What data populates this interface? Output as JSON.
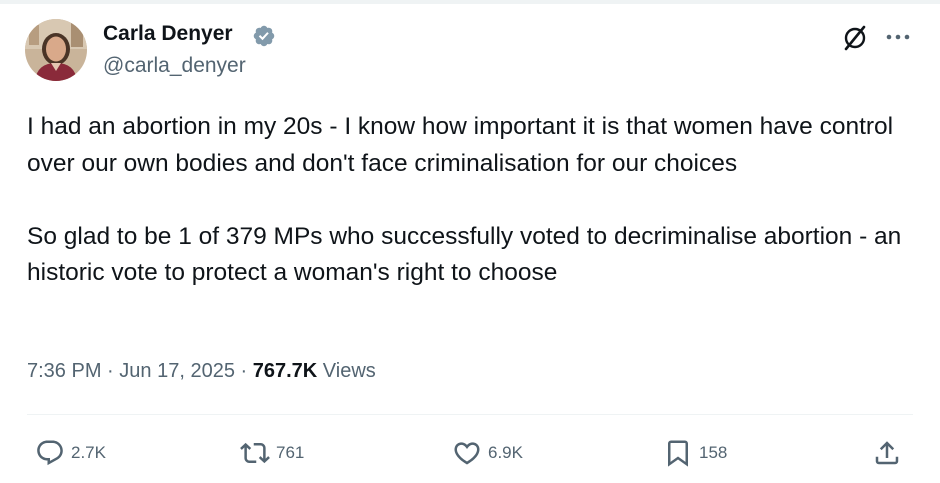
{
  "author": {
    "name": "Carla Denyer",
    "handle": "@carla_denyer",
    "verified": true,
    "avatar": "avatar-photo"
  },
  "tweet": {
    "paragraphs": [
      "I had an abortion in my 20s - I know how important it is that women have control over our own bodies and don't face criminalisation for our choices",
      "So glad to be 1 of 379 MPs who successfully voted to decriminalise abortion - an historic vote to protect a woman's right to choose"
    ],
    "time": "7:36 PM",
    "separator": "·",
    "date": "Jun 17, 2025",
    "views_count": "767.7K",
    "views_label": "Views"
  },
  "actions": {
    "reply": {
      "icon": "reply-icon",
      "count": "2.7K"
    },
    "repost": {
      "icon": "repost-icon",
      "count": "761"
    },
    "like": {
      "icon": "heart-icon",
      "count": "6.9K"
    },
    "bookmark": {
      "icon": "bookmark-icon",
      "count": "158"
    },
    "share": {
      "icon": "share-icon"
    }
  },
  "header_icons": [
    "grok-icon",
    "more-icon"
  ],
  "colors": {
    "text": "#0f1419",
    "secondary": "#536471",
    "verified": "#829aab",
    "divider": "#eff3f4",
    "background": "#ffffff"
  }
}
